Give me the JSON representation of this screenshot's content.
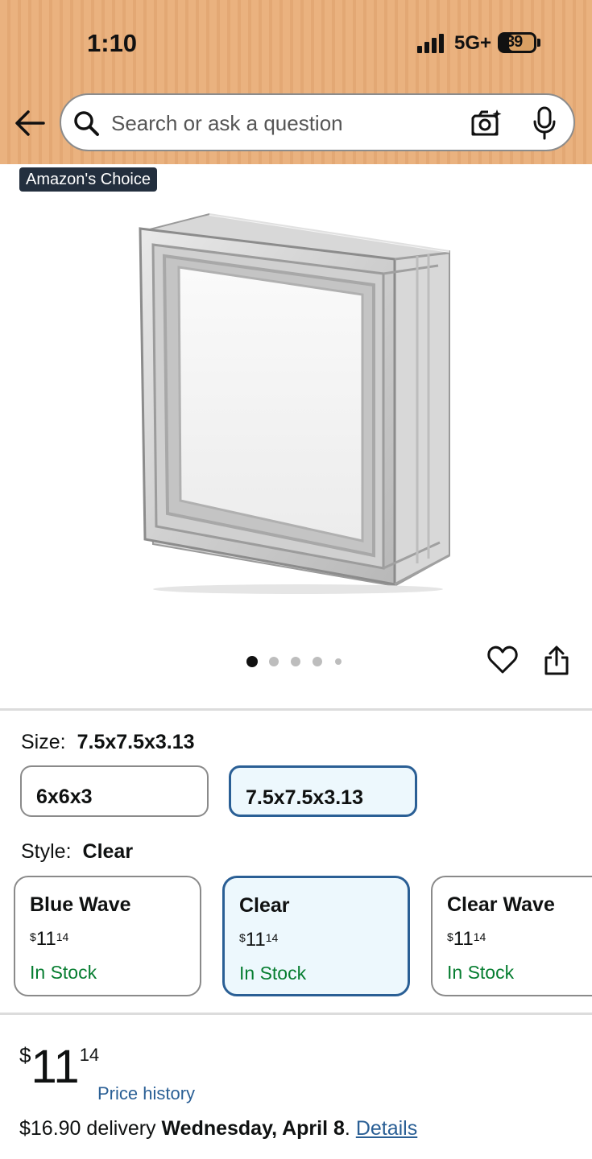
{
  "status_bar": {
    "time": "1:10",
    "network": "5G+",
    "battery": "39"
  },
  "search": {
    "placeholder": "Search or ask a question"
  },
  "product": {
    "badge": "Amazon's Choice",
    "image_count": 5,
    "current_image": 1
  },
  "size": {
    "label": "Size:",
    "selected": "7.5x7.5x3.13",
    "options": [
      "6x6x3",
      "7.5x7.5x3.13"
    ]
  },
  "style": {
    "label": "Style:",
    "selected": "Clear",
    "options": [
      {
        "name": "Blue Wave",
        "currency": "$",
        "whole": "11",
        "fraction": "14",
        "stock": "In Stock"
      },
      {
        "name": "Clear",
        "currency": "$",
        "whole": "11",
        "fraction": "14",
        "stock": "In Stock"
      },
      {
        "name": "Clear Wave",
        "currency": "$",
        "whole": "11",
        "fraction": "14",
        "stock": "In Stock"
      }
    ]
  },
  "price": {
    "currency": "$",
    "whole": "11",
    "fraction": "14",
    "history_link": "Price history"
  },
  "delivery": {
    "fee": "$16.90 delivery",
    "date": "Wednesday, April 8",
    "period": ".",
    "details_link": "Details"
  },
  "colors": {
    "header_bg": "#eab27f",
    "badge_bg": "#232f3e",
    "selected_border": "#2a5f95",
    "selected_bg": "#edf8fd",
    "stock_green": "#067d30",
    "link_blue": "#2a5f95"
  }
}
